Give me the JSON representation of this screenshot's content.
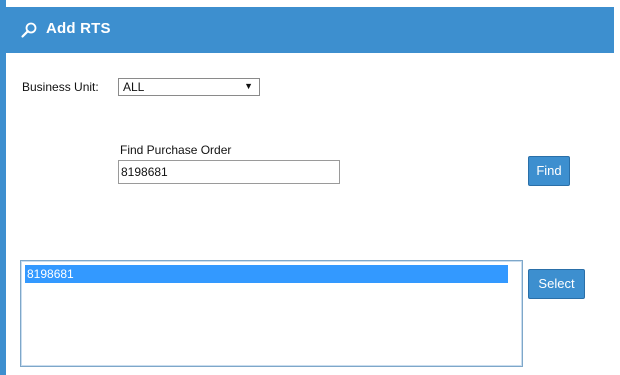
{
  "header": {
    "title": "Add RTS",
    "icon": "magnifier-icon",
    "color": "#3d8fcf"
  },
  "business_unit": {
    "label": "Business Unit:",
    "selected": "ALL",
    "arrow": "▼"
  },
  "find_po": {
    "label": "Find Purchase Order",
    "value": "8198681",
    "button_label": "Find"
  },
  "results": {
    "items": [
      "8198681"
    ],
    "selected_index": 0,
    "button_label": "Select",
    "highlight_color": "#3399ff"
  }
}
